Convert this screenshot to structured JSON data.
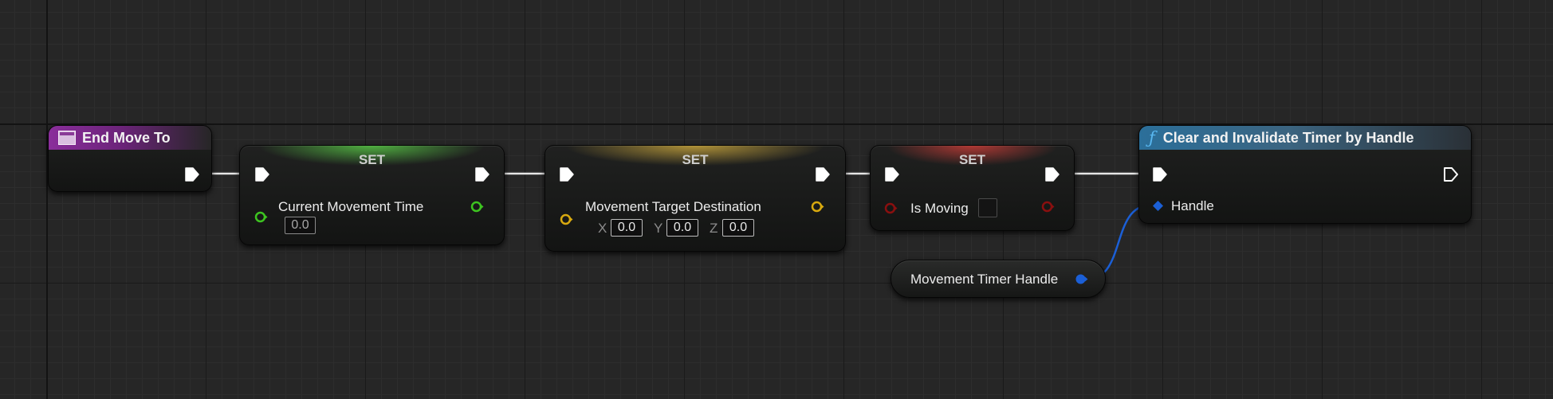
{
  "graph": {
    "event_node": {
      "title": "End Move To",
      "icon": "event-icon"
    },
    "set_time": {
      "title": "SET",
      "var_label": "Current Movement Time",
      "value": "0.0",
      "pin_color": "#3dc420"
    },
    "set_destination": {
      "title": "SET",
      "var_label": "Movement Target Destination",
      "x_label": "X",
      "x_value": "0.0",
      "y_label": "Y",
      "y_value": "0.0",
      "z_label": "Z",
      "z_value": "0.0",
      "pin_color": "#d8a90f"
    },
    "set_moving": {
      "title": "SET",
      "var_label": "Is Moving",
      "checked": false,
      "pin_color": "#8a0f0f"
    },
    "get_handle": {
      "label": "Movement Timer Handle",
      "pin_color": "#1b5fd6"
    },
    "clear_timer": {
      "title": "Clear and Invalidate Timer by Handle",
      "icon": "function-icon",
      "input_label": "Handle"
    }
  },
  "colors": {
    "exec_wire": "#e6e6e6",
    "struct_wire": "#1b5fd6"
  }
}
